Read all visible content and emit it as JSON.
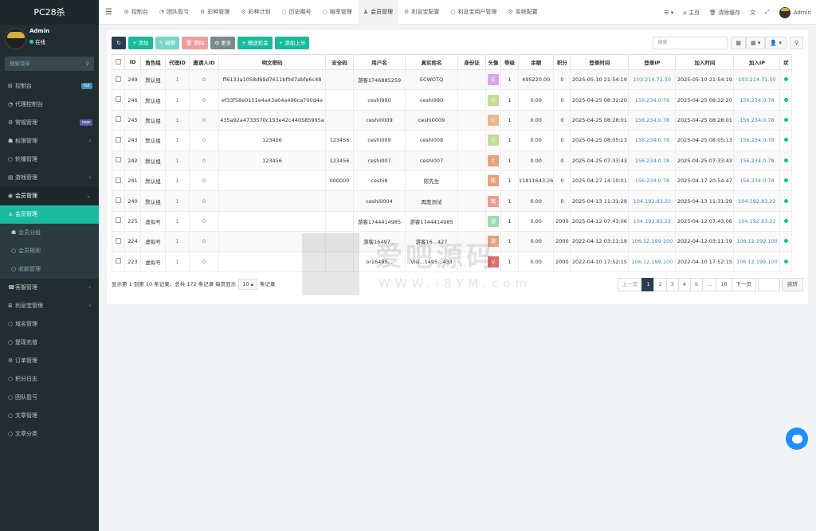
{
  "app": {
    "title": "PC28杀"
  },
  "user": {
    "name": "Admin",
    "status": "在线"
  },
  "sidebar": {
    "search_placeholder": "搜索菜单",
    "items": [
      {
        "label": "控制台",
        "icon": "dashboard-icon",
        "badge": "hot",
        "badge_color": "#3c8dbc"
      },
      {
        "label": "代理控制台",
        "icon": "gauge-icon"
      },
      {
        "label": "常规管理",
        "icon": "cog-icon",
        "badge": "new",
        "badge_color": "#605ca8"
      },
      {
        "label": "权限管理",
        "icon": "group-icon",
        "arrow": true
      },
      {
        "label": "轮播管理",
        "icon": "circle-icon"
      },
      {
        "label": "游戏管理",
        "icon": "folder-icon",
        "arrow": true
      },
      {
        "label": "会员管理",
        "icon": "user-circle-icon",
        "arrow": false
      },
      {
        "label": "会员管理",
        "icon": "user-icon"
      },
      {
        "label": "会员分组",
        "icon": "users-icon"
      },
      {
        "label": "会员规则",
        "icon": "circle-icon"
      },
      {
        "label": "收款管理",
        "icon": "circle-icon"
      },
      {
        "label": "客服管理",
        "icon": "support-icon",
        "arrow": true
      },
      {
        "label": "利息宝管理",
        "icon": "list-icon",
        "arrow": true
      },
      {
        "label": "域名管理",
        "icon": "circle-icon"
      },
      {
        "label": "提现充值",
        "icon": "circle-icon"
      },
      {
        "label": "订单管理",
        "icon": "gear-icon"
      },
      {
        "label": "积分日志",
        "icon": "circle-icon"
      },
      {
        "label": "团队盈亏",
        "icon": "circle-icon"
      },
      {
        "label": "文章管理",
        "icon": "circle-icon"
      },
      {
        "label": "文章分类",
        "icon": "circle-icon"
      }
    ]
  },
  "topbar": {
    "tabs": [
      "控制台",
      "团队盈亏",
      "彩种管理",
      "彩种计划",
      "历史期号",
      "赔率管理",
      "会员管理",
      "利息宝配置",
      "利息宝用户管理",
      "系统配置"
    ],
    "right": {
      "home": "主页",
      "clear": "清除缓存",
      "admin": "Admin"
    }
  },
  "toolbar": {
    "add": "添加",
    "edit": "编辑",
    "delete": "删除",
    "more": "更多",
    "red_points": "赠送彩金",
    "add_superior": "添加上分",
    "search_placeholder": "搜索"
  },
  "table": {
    "headers": [
      "ID",
      "角色组",
      "代理ID",
      "邀请人ID",
      "明文密码",
      "安全码",
      "用户名",
      "真实姓名",
      "身份证",
      "头像",
      "等级",
      "余额",
      "积分",
      "登录时间",
      "登录IP",
      "加入时间",
      "加入IP",
      "状"
    ],
    "rows": [
      {
        "id": "249",
        "group": "默认组",
        "agent": "1",
        "inviter": "0",
        "pwd": "ff6133a1058d69d7611bf0d7abfe6c48",
        "code": "",
        "username": "游客1746885259",
        "realname": "ECWOTQ",
        "idcard": "",
        "avatar": "E",
        "avatar_color": "#d9a7e8",
        "level": "1",
        "balance": "495220.00",
        "points": "0",
        "login_time": "2025-05-10 21:54:19",
        "login_ip": "103.214.71.50",
        "join_time": "2025-05-10 21:54:19",
        "join_ip": "103.214.71.50"
      },
      {
        "id": "246",
        "group": "默认组",
        "agent": "1",
        "inviter": "0",
        "pwd": "ef33f58e0151e4a43a64a496ca700d4e",
        "code": "",
        "username": "ceshi990",
        "realname": "ceshi990",
        "idcard": "",
        "avatar": "C",
        "avatar_color": "#c3dd9a",
        "level": "1",
        "balance": "0.00",
        "points": "0",
        "login_time": "2025-04-25 08:32:20",
        "login_ip": "156.234.0.78",
        "join_time": "2025-04-25 08:32:20",
        "join_ip": "156.234.0.78"
      },
      {
        "id": "245",
        "group": "默认组",
        "agent": "1",
        "inviter": "0",
        "pwd": "435a92a4733570c153e42c440585995a",
        "code": "",
        "username": "ceshi0009",
        "realname": "ceshi0009",
        "idcard": "",
        "avatar": "C",
        "avatar_color": "#e6b98c",
        "level": "1",
        "balance": "0.00",
        "points": "0",
        "login_time": "2025-04-25 08:28:01",
        "login_ip": "156.234.0.78",
        "join_time": "2025-04-25 08:28:01",
        "join_ip": "156.234.0.78"
      },
      {
        "id": "243",
        "group": "默认组",
        "agent": "1",
        "inviter": "0",
        "pwd": "123456",
        "code": "123456",
        "username": "ceshi009",
        "realname": "ceshi009",
        "idcard": "",
        "avatar": "C",
        "avatar_color": "#c3dd9a",
        "level": "1",
        "balance": "0.00",
        "points": "0",
        "login_time": "2025-04-25 08:05:13",
        "login_ip": "156.234.0.78",
        "join_time": "2025-04-25 08:05:13",
        "join_ip": "156.234.0.78"
      },
      {
        "id": "242",
        "group": "默认组",
        "agent": "1",
        "inviter": "0",
        "pwd": "123456",
        "code": "123456",
        "username": "ceshi007",
        "realname": "ceshi007",
        "idcard": "",
        "avatar": "C",
        "avatar_color": "#e8a07e",
        "level": "1",
        "balance": "0.00",
        "points": "0",
        "login_time": "2025-04-25 07:33:43",
        "login_ip": "156.234.0.78",
        "join_time": "2025-04-25 07:33:43",
        "join_ip": "156.234.0.78"
      },
      {
        "id": "241",
        "group": "默认组",
        "agent": "1",
        "inviter": "0",
        "pwd": "",
        "code": "000000",
        "username": "ceshi8",
        "realname": "陈先生",
        "idcard": "",
        "avatar": "陈",
        "avatar_color": "#e8a07e",
        "level": "1",
        "balance": "11811643.26",
        "points": "0",
        "login_time": "2025-04-27 14:10:01",
        "login_ip": "156.234.0.78",
        "join_time": "2025-04-17 20:54:47",
        "join_ip": "156.234.0.78"
      },
      {
        "id": "240",
        "group": "默认组",
        "agent": "1",
        "inviter": "0",
        "pwd": "",
        "code": "",
        "username": "ceshi0004",
        "realname": "再度测试",
        "idcard": "",
        "avatar": "再",
        "avatar_color": "#e8a090",
        "level": "1",
        "balance": "0.00",
        "points": "0",
        "login_time": "2025-04-13 11:31:29",
        "login_ip": "104.192.83.22",
        "join_time": "2025-04-13 11:31:29",
        "join_ip": "104.192.83.22"
      },
      {
        "id": "225",
        "group": "虚拟号",
        "agent": "1",
        "inviter": "0",
        "pwd": "",
        "code": "",
        "username": "游客1744414985",
        "realname": "游客1744414985",
        "idcard": "",
        "avatar": "游",
        "avatar_color": "#9ddbb5",
        "level": "1",
        "balance": "0.00",
        "points": "2000",
        "login_time": "2025-04-12 07:43:06",
        "login_ip": "104.192.83.22",
        "join_time": "2025-04-12 07:43:06",
        "join_ip": "104.192.83.22"
      },
      {
        "id": "224",
        "group": "虚拟号",
        "agent": "1",
        "inviter": "0",
        "pwd": "",
        "code": "",
        "username": "游客16497...",
        "realname": "游客16...427",
        "idcard": "",
        "avatar": "游",
        "avatar_color": "#e8a07e",
        "level": "1",
        "balance": "0.00",
        "points": "2000",
        "login_time": "2022-04-12 03:11:19",
        "login_ip": "106.12.199.100",
        "join_time": "2022-04-12 03:11:19",
        "join_ip": "106.12.199.100"
      },
      {
        "id": "223",
        "group": "虚拟号",
        "agent": "1",
        "inviter": "0",
        "pwd": "",
        "code": "",
        "username": "or16495...",
        "realname": "Visi...1495...433",
        "idcard": "",
        "avatar": "V",
        "avatar_color": "#e07070",
        "level": "1",
        "balance": "0.00",
        "points": "2000",
        "login_time": "2022-04-10 17:52:15",
        "login_ip": "106.12.199.100",
        "join_time": "2022-04-10 17:52:15",
        "join_ip": "106.12.199.100"
      }
    ]
  },
  "footer": {
    "showing": "显示第 1 到第 10 条记录，总共 172 条记录 每页显示",
    "per_page": "10",
    "records": "条记录"
  },
  "pagination": {
    "prev": "上一页",
    "pages": [
      "1",
      "2",
      "3",
      "4",
      "5",
      "...",
      "18"
    ],
    "next": "下一页",
    "jump": "跳转"
  },
  "watermark": {
    "text": "爱吧源码",
    "url": "WWW.i8YM.com"
  }
}
